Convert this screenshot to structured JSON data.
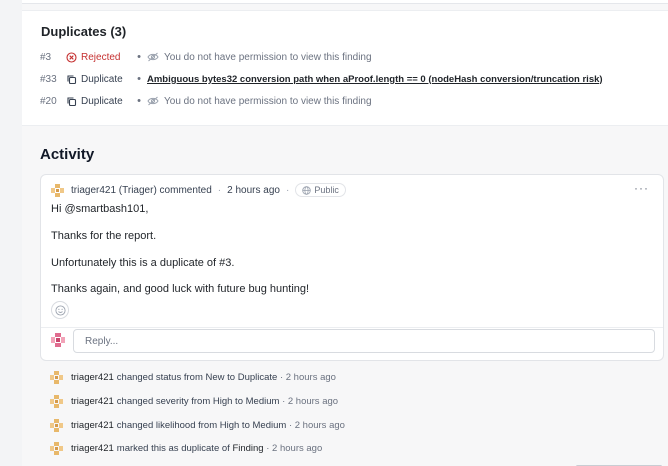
{
  "duplicates": {
    "title": "Duplicates (3)",
    "items": [
      {
        "number": "#3",
        "status": "Rejected",
        "status_icon": "x-circle-icon",
        "text": "You do not have permission to view this finding",
        "restricted": true
      },
      {
        "number": "#33",
        "status": "Duplicate",
        "status_icon": "copy-icon",
        "text": "Ambiguous bytes32 conversion path when aProof.length == 0 (nodeHash conversion/truncation risk)",
        "restricted": false
      },
      {
        "number": "#20",
        "status": "Duplicate",
        "status_icon": "copy-icon",
        "text": "You do not have permission to view this finding",
        "restricted": true
      }
    ],
    "separator": "•"
  },
  "activity": {
    "title": "Activity",
    "comment": {
      "author": "triager421 (Triager) commented",
      "time": "2 hours ago",
      "visibility": "Public",
      "greeting_prefix": "Hi",
      "mention": "@smartbash101",
      "greeting_suffix": ",",
      "paragraphs": [
        "Thanks for the report.",
        "Unfortunately this is a duplicate of #3.",
        "Thanks again, and good luck with future bug hunting!"
      ],
      "more_icon": "ellipsis-icon",
      "reaction_icon": "smiley-icon"
    },
    "reply": {
      "placeholder": "Reply..."
    },
    "events": [
      {
        "user": "triager421",
        "action": "changed status from New to Duplicate",
        "time": "· 2 hours ago"
      },
      {
        "user": "triager421",
        "action": "changed severity from High to Medium",
        "time": "· 2 hours ago"
      },
      {
        "user": "triager421",
        "action": "changed likelihood from High to Medium",
        "time": "· 2 hours ago"
      },
      {
        "user": "triager421",
        "action": "marked this as duplicate of",
        "target": "Finding",
        "time": "· 2 hours ago"
      }
    ],
    "sep": "·"
  },
  "colors": {
    "rejected": "#c53030",
    "text": "#1f2328",
    "muted": "#6b7280",
    "avatar_pink": "#e06c8f"
  }
}
